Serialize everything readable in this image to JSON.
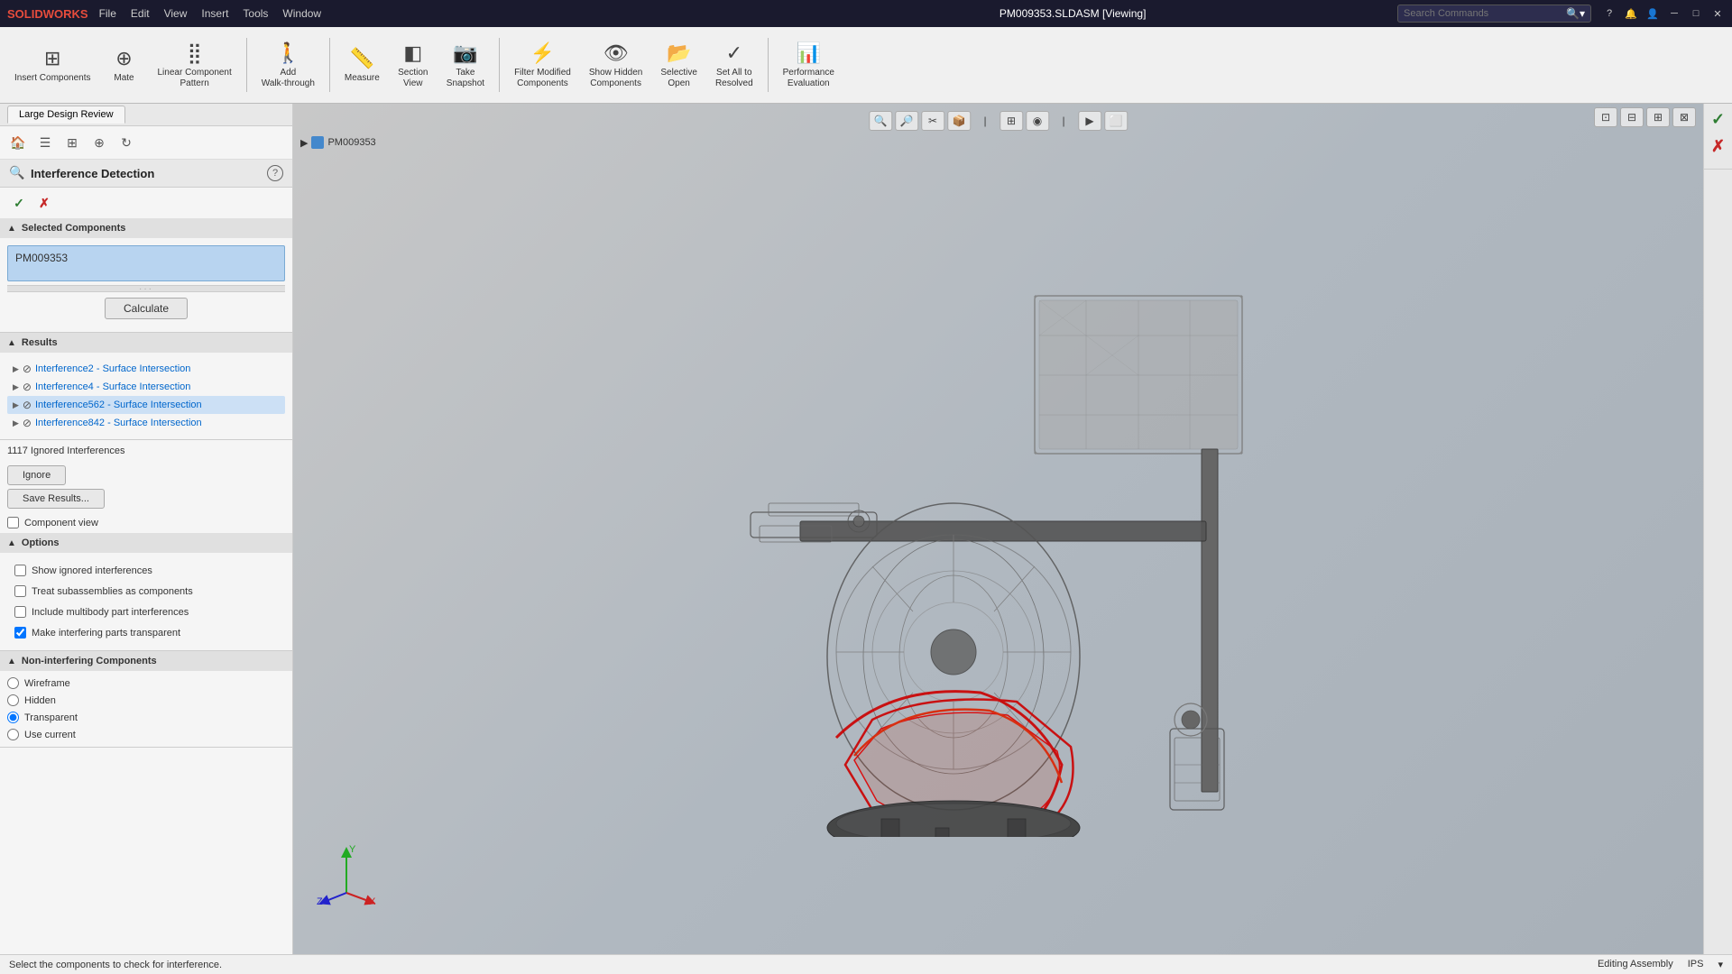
{
  "titlebar": {
    "logo": "SOLIDWORKS",
    "menu_items": [
      "File",
      "Edit",
      "View",
      "Insert",
      "Tools",
      "Window"
    ],
    "title": "PM009353.SLDASM [Viewing]",
    "search_placeholder": "Search Commands",
    "pin_label": "📌"
  },
  "toolbar": {
    "items": [
      {
        "id": "insert-components",
        "icon": "⊞",
        "label": "Insert\nComponents"
      },
      {
        "id": "mate",
        "icon": "⊕",
        "label": "Mate"
      },
      {
        "id": "linear-component-pattern",
        "icon": "⣿",
        "label": "Linear Component\nPattern"
      },
      {
        "id": "add-walk-through",
        "icon": "🚶",
        "label": "Add\nWalk-through"
      },
      {
        "id": "measure",
        "icon": "📏",
        "label": "Measure",
        "active": true
      },
      {
        "id": "section-view",
        "icon": "◧",
        "label": "Section\nView"
      },
      {
        "id": "take-snapshot",
        "icon": "📷",
        "label": "Take\nSnapshot"
      },
      {
        "id": "filter-modified",
        "icon": "⚡",
        "label": "Filter Modified\nComponents"
      },
      {
        "id": "show-hidden",
        "icon": "👁",
        "label": "Show Hidden\nComponents"
      },
      {
        "id": "selective-open",
        "icon": "📂",
        "label": "Selective\nOpen"
      },
      {
        "id": "set-all-resolved",
        "icon": "✓",
        "label": "Set All to\nResolved"
      },
      {
        "id": "performance-eval",
        "icon": "📊",
        "label": "Performance\nEvaluation"
      }
    ]
  },
  "tab_bar": {
    "tabs": [
      {
        "id": "large-design-review",
        "label": "Large Design Review",
        "active": true
      }
    ]
  },
  "panel_icons": [
    "🏠",
    "☰",
    "🔲",
    "⊕",
    "↻"
  ],
  "interference_detection": {
    "title": "Interference Detection",
    "ok_label": "✓",
    "cancel_label": "✗",
    "selected_components_label": "Selected Components",
    "selected_item": "PM009353",
    "calculate_label": "Calculate",
    "results_label": "Results",
    "results": [
      {
        "id": 1,
        "label": "Interference2 - Surface Intersection",
        "selected": false
      },
      {
        "id": 2,
        "label": "Interference4 - Surface Intersection",
        "selected": false
      },
      {
        "id": 3,
        "label": "Interference562 - Surface Intersection",
        "selected": true
      },
      {
        "id": 4,
        "label": "Interference842 - Surface Intersection",
        "selected": false
      }
    ],
    "ignored_count": "1117 Ignored Interferences",
    "ignore_label": "Ignore",
    "save_results_label": "Save Results...",
    "component_view_label": "Component view",
    "options_label": "Options",
    "options": [
      {
        "id": "show-ignored",
        "label": "Show ignored interferences",
        "checked": false
      },
      {
        "id": "treat-subassemblies",
        "label": "Treat subassemblies as components",
        "checked": false
      },
      {
        "id": "include-multibody",
        "label": "Include multibody part interferences",
        "checked": false
      },
      {
        "id": "make-transparent",
        "label": "Make interfering parts transparent",
        "checked": true
      }
    ],
    "non_interfering_label": "Non-interfering Components",
    "non_interfering_options": [
      {
        "id": "wireframe",
        "label": "Wireframe",
        "selected": false
      },
      {
        "id": "hidden",
        "label": "Hidden",
        "selected": false
      },
      {
        "id": "transparent",
        "label": "Transparent",
        "selected": true
      },
      {
        "id": "use-current",
        "label": "Use current",
        "selected": false
      }
    ]
  },
  "viewport": {
    "breadcrumb": "PM009353",
    "toolbar_icons": [
      "🔍",
      "🔎",
      "✂",
      "📦",
      "⊞",
      "◉",
      "🔺",
      "⬡",
      "▶",
      "⬜"
    ],
    "right_icons": [
      "✓",
      "✗"
    ],
    "corner_icons": [
      "⊡",
      "⊟",
      "⊞",
      "⊠"
    ]
  },
  "statusbar": {
    "message": "Select the components to check for interference.",
    "editing": "Editing Assembly",
    "ips": "IPS",
    "arrow": "▾"
  }
}
